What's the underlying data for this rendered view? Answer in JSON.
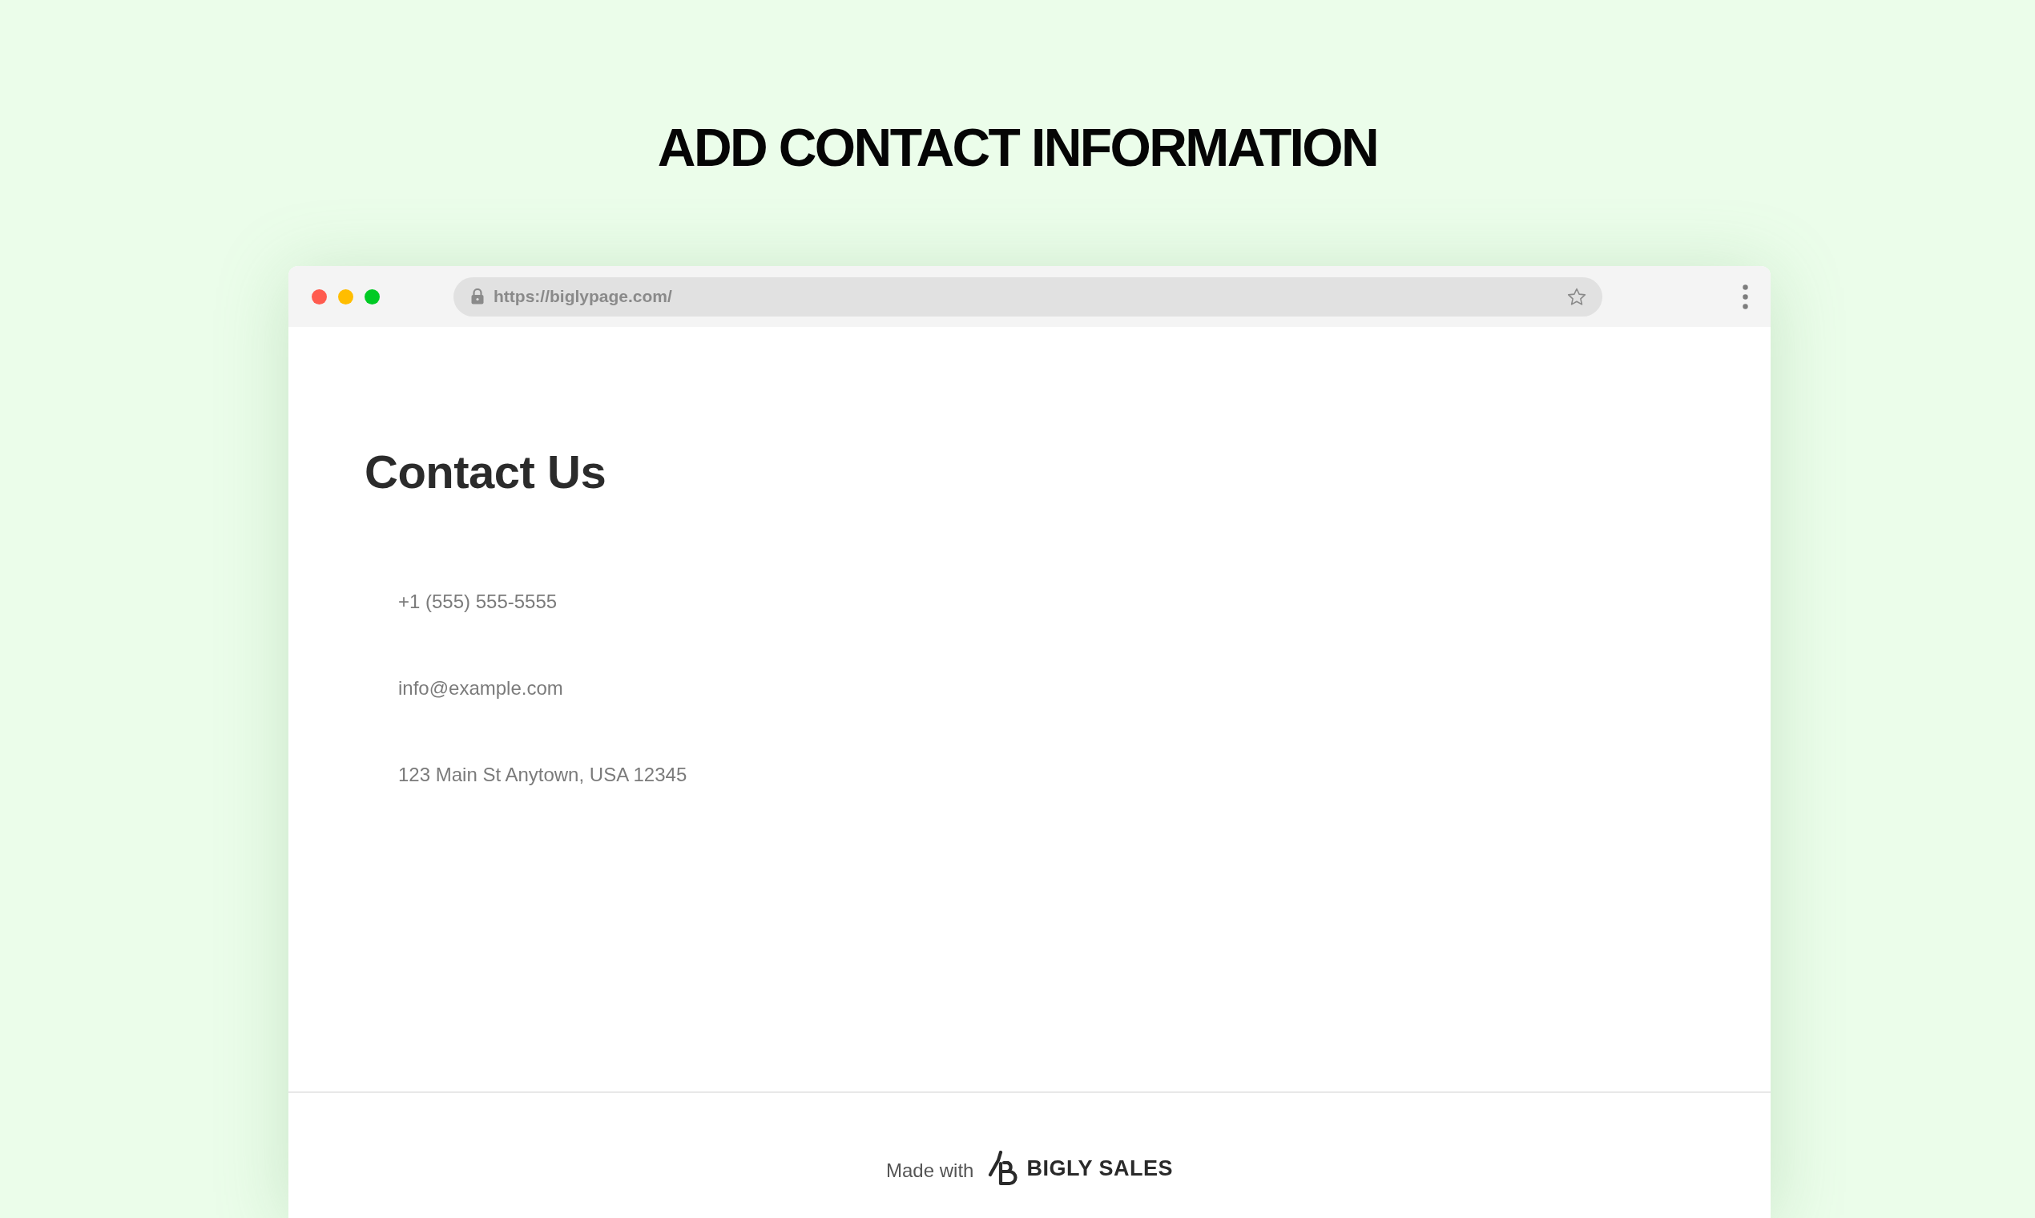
{
  "heading": "ADD CONTACT INFORMATION",
  "browser": {
    "window_controls": [
      {
        "color": "#ff5b4f"
      },
      {
        "color": "#ffbd00"
      },
      {
        "color": "#00ca24"
      }
    ],
    "address": "https://biglypage.com/"
  },
  "page": {
    "title": "Contact Us",
    "contacts": [
      "+1 (555) 555-5555",
      "info@example.com",
      "123 Main St Anytown, USA 12345"
    ]
  },
  "footer": {
    "made_with": "Made with",
    "brand": "BIGLY SALES"
  }
}
